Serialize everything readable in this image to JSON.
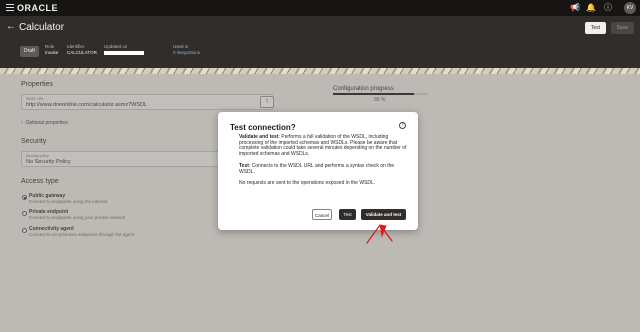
{
  "topbar": {
    "logo": "ORACLE",
    "avatar_initials": "KV",
    "icons": [
      "hamburger-icon",
      "megaphone-icon",
      "bell-icon",
      "help-icon"
    ]
  },
  "header": {
    "title": "Calculator",
    "test_label": "Test",
    "save_label": "Save",
    "status_badge": "Draft",
    "meta": [
      {
        "label": "Role",
        "value": "Invoke"
      },
      {
        "label": "Identifier",
        "value": "CALCULATOR"
      },
      {
        "label": "Updated on",
        "value": ""
      },
      {
        "label": "Used in",
        "value": "0 integrations"
      }
    ]
  },
  "properties": {
    "heading": "Properties",
    "wsdl_label": "WSDL URL",
    "wsdl_value": "http://www.dneonline.com/calculator.asmx?WSDL",
    "optional_label": "Optional properties"
  },
  "security": {
    "heading": "Security",
    "label": "Security policy",
    "value": "No Security Policy"
  },
  "access": {
    "heading": "Access type",
    "options": [
      {
        "title": "Public gateway",
        "desc": "Connect to endpoints using the internet",
        "selected": true
      },
      {
        "title": "Private endpoint",
        "desc": "Connect to endpoints using your private network",
        "selected": false
      },
      {
        "title": "Connectivity agent",
        "desc": "Connect to on-premises endpoints through the agent",
        "selected": false
      }
    ]
  },
  "config": {
    "heading": "Configuration progress",
    "percent_text": "85 %",
    "percent": 85
  },
  "dialog": {
    "title": "Test connection?",
    "p1_bold": "Validate and test",
    "p1_text": ": Performs a full validation of the WSDL, including processing of the imported schemas and WSDLs. Please be aware that complete validation could take several minutes depending on the number of imported schemas and WSDLs.",
    "p2_bold": "Test",
    "p2_text": ": Connects to the WSDL URL and performs a syntax check on the WSDL.",
    "p3_text": "No requests are sent to the operations exposed in the WSDL.",
    "cancel_label": "Cancel",
    "test_label": "Test",
    "validate_label": "Validate and test"
  },
  "colors": {
    "topbar": "#161513",
    "header": "#312d2a",
    "annotation": "#e01b1b"
  }
}
